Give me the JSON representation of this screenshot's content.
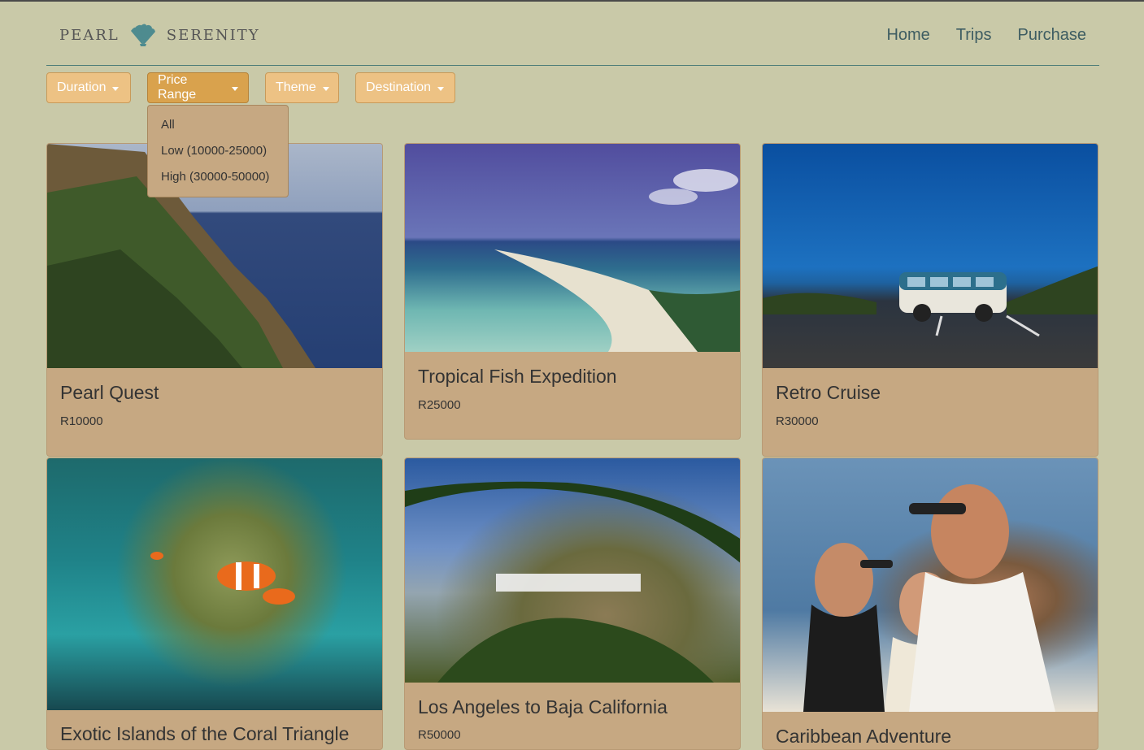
{
  "brand": {
    "left": "PEARL",
    "right": "SERENITY",
    "logo_icon": "shell-icon"
  },
  "nav": {
    "items": [
      "Home",
      "Trips",
      "Purchase"
    ]
  },
  "filters": [
    {
      "label": "Duration"
    },
    {
      "label": "Price Range"
    },
    {
      "label": "Theme"
    },
    {
      "label": "Destination"
    }
  ],
  "price_dropdown": {
    "open": true,
    "options": [
      "All",
      "Low (10000-25000)",
      "High (30000-50000)"
    ]
  },
  "trips": [
    {
      "title": "Pearl Quest",
      "price": "R10000",
      "image": "coastal-cliff-photo"
    },
    {
      "title": "Tropical Fish Expedition",
      "price": "R25000",
      "image": "tropical-beach-aerial-photo"
    },
    {
      "title": "Retro Cruise",
      "price": "R30000",
      "image": "retro-van-ocean-photo"
    },
    {
      "title": "Exotic Islands of the Coral Triangle",
      "price": "",
      "image": "clownfish-reef-photo"
    },
    {
      "title": "Los Angeles to Baja California",
      "price": "R50000",
      "image": "hollywood-sign-palm-photo"
    },
    {
      "title": "Caribbean Adventure",
      "price": "",
      "image": "family-selfie-photo"
    }
  ],
  "colors": {
    "background": "#c9c9a8",
    "accent": "#edc284",
    "accent_active": "#d9a24d",
    "card": "#c6a882",
    "nav_text": "#3e5d62"
  }
}
